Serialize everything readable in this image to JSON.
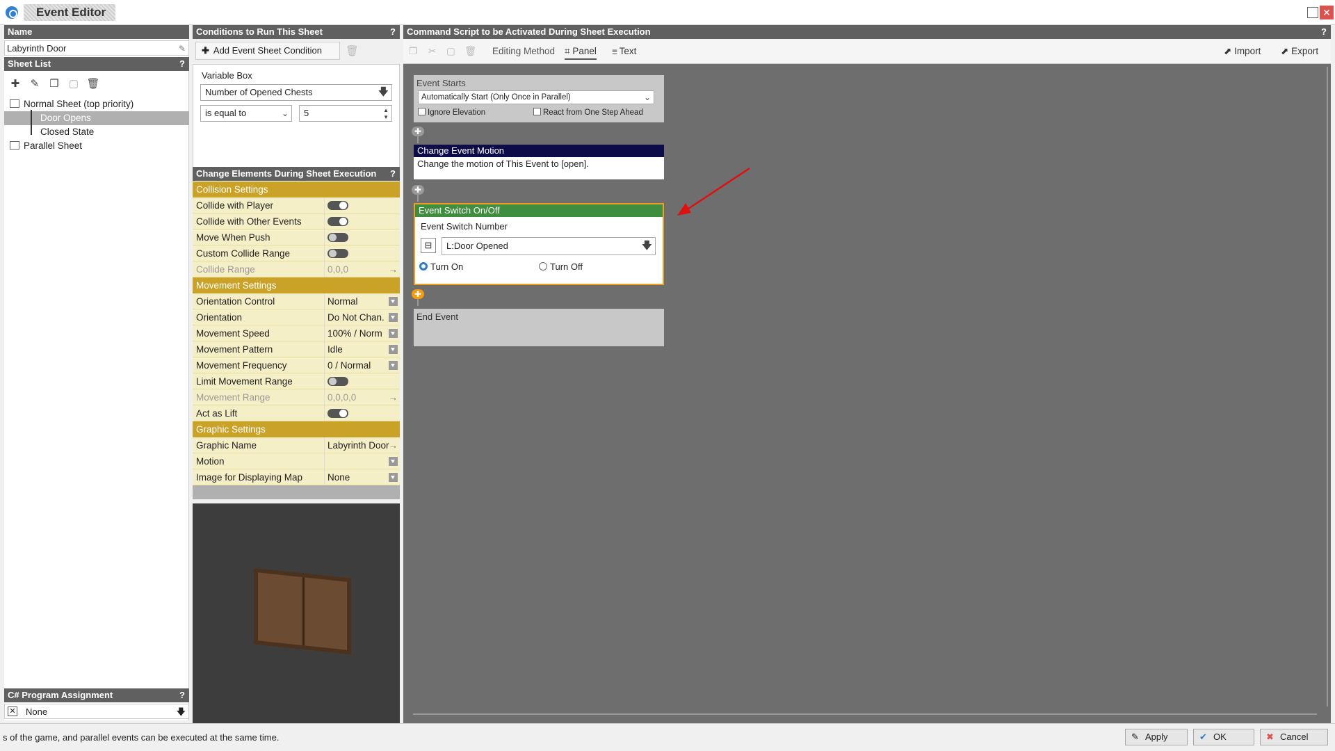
{
  "window": {
    "title": "Event Editor"
  },
  "name_panel": {
    "header": "Name",
    "help": "?",
    "value": "Labyrinth Door"
  },
  "sheet_list": {
    "header": "Sheet List",
    "help": "?",
    "items": [
      "Normal Sheet (top priority)",
      "Door Opens",
      "Closed State",
      "Parallel Sheet"
    ]
  },
  "csharp": {
    "header": "C# Program Assignment",
    "help": "?",
    "value": "None"
  },
  "conditions": {
    "header": "Conditions to Run This Sheet",
    "help": "?",
    "add_label": "Add Event Sheet Condition",
    "group_label": "Variable Box",
    "variable": "Number of Opened Chests",
    "operator": "is equal to",
    "value": "5"
  },
  "elements": {
    "header": "Change Elements During Sheet Execution",
    "help": "?",
    "sections": [
      {
        "title": "Collision Settings",
        "rows": [
          {
            "label": "Collide with Player",
            "toggle": "on"
          },
          {
            "label": "Collide with Other Events",
            "toggle": "on"
          },
          {
            "label": "Move When Push",
            "toggle": "off"
          },
          {
            "label": "Custom Collide Range",
            "toggle": "off"
          },
          {
            "label": "Collide Range",
            "value": "0,0,0",
            "disabled": true,
            "arrow": true
          }
        ]
      },
      {
        "title": "Movement Settings",
        "rows": [
          {
            "label": "Orientation Control",
            "value": "Normal",
            "dropdown": true
          },
          {
            "label": "Orientation",
            "value": "Do Not Chan.",
            "dropdown": true
          },
          {
            "label": "Movement Speed",
            "value": "100% / Norm",
            "dropdown": true
          },
          {
            "label": "Movement Pattern",
            "value": "Idle",
            "dropdown": true
          },
          {
            "label": "Movement Frequency",
            "value": "0 / Normal",
            "dropdown": true
          },
          {
            "label": "Limit Movement Range",
            "toggle": "off"
          },
          {
            "label": "Movement Range",
            "value": "0,0,0,0",
            "disabled": true,
            "arrow": true
          },
          {
            "label": "Act as Lift",
            "toggle": "on"
          }
        ]
      },
      {
        "title": "Graphic Settings",
        "rows": [
          {
            "label": "Graphic Name",
            "value": "Labyrinth Door",
            "arrow": true
          },
          {
            "label": "Motion",
            "value": "",
            "dropdown": true
          },
          {
            "label": "Image for Displaying Map",
            "value": "None",
            "dropdown": true
          }
        ]
      }
    ]
  },
  "script": {
    "header": "Command Script to be Activated During Sheet Execution",
    "help": "?",
    "toolbar": {
      "editing_method": "Editing Method",
      "panel": "Panel",
      "text": "Text",
      "import": "Import",
      "export": "Export"
    },
    "event_starts": {
      "title": "Event Starts",
      "trigger": "Automatically Start (Only Once in Parallel)",
      "ignore_elevation": "Ignore Elevation",
      "react_one_step": "React from One Step Ahead"
    },
    "motion_block": {
      "title": "Change Event Motion",
      "text": "Change the motion of This Event to [open]."
    },
    "switch_block": {
      "title": "Event Switch On/Off",
      "field_label": "Event Switch Number",
      "switch_value": "L:Door Opened",
      "turn_on": "Turn On",
      "turn_off": "Turn Off"
    },
    "end_block": {
      "title": "End Event"
    }
  },
  "statusbar": {
    "text": "s of the game, and parallel events can be executed at the same time.",
    "apply": "Apply",
    "ok": "OK",
    "cancel": "Cancel"
  },
  "colors": {
    "section_gold": "#c9a227",
    "motion_header": "#0c0c48",
    "switch_header": "#3f8d3f",
    "highlight_orange": "#f0a020",
    "annotation_red": "#e01010"
  }
}
